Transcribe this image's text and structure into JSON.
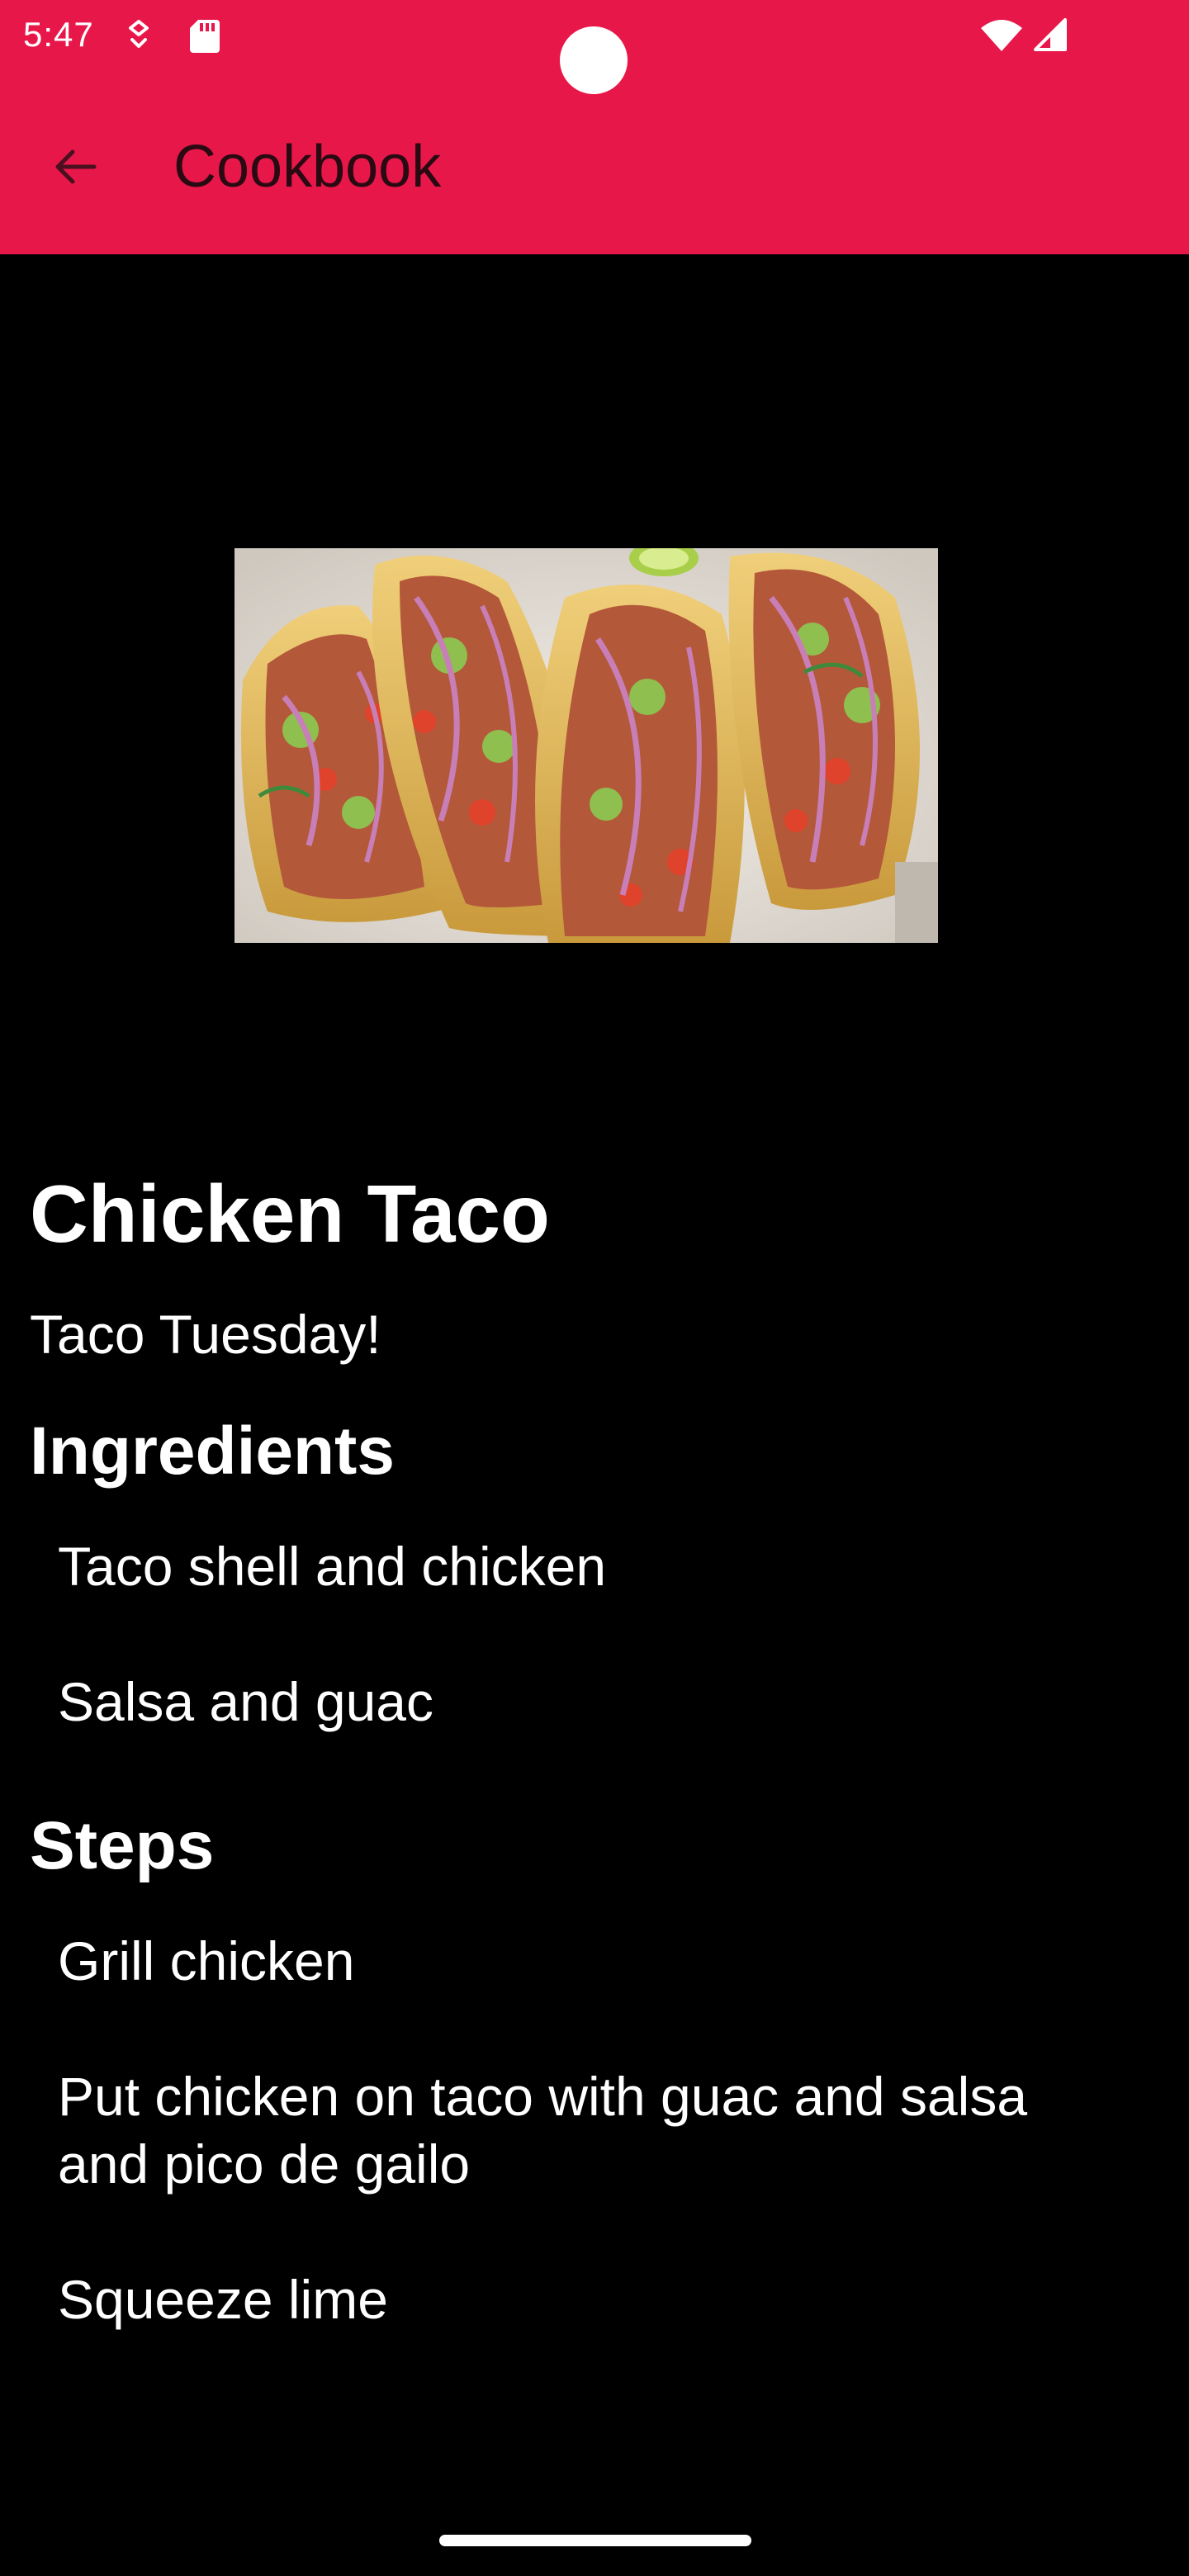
{
  "status_bar": {
    "time": "5:47"
  },
  "app_bar": {
    "title": "Cookbook"
  },
  "recipe": {
    "title": "Chicken Taco",
    "subtitle": "Taco Tuesday!",
    "ingredients_heading": "Ingredients",
    "ingredients": [
      "Taco shell and chicken",
      "Salsa and guac"
    ],
    "steps_heading": "Steps",
    "steps": [
      "Grill chicken",
      "Put chicken on taco with guac and salsa and pico de gailo",
      "Squeeze lime"
    ]
  },
  "icons": {
    "back": "arrow-back-icon",
    "wifi": "wifi-icon",
    "signal": "cell-signal-icon"
  },
  "colors": {
    "app_bar": "#E8174A",
    "background": "#000000",
    "text": "#FFFFFF"
  }
}
